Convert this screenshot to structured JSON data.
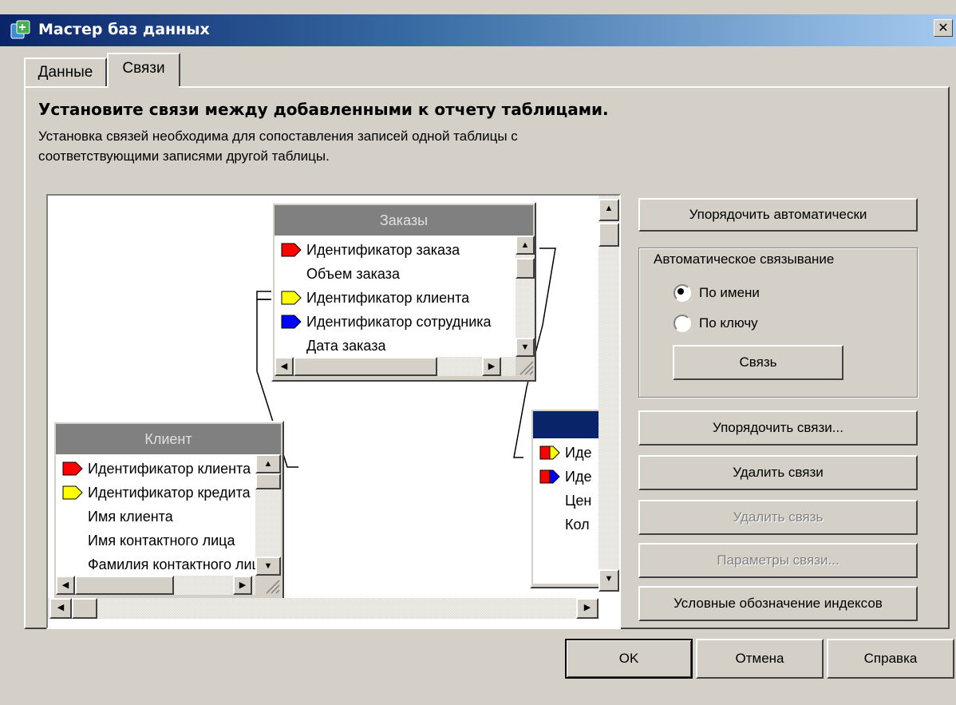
{
  "window": {
    "title": "Мастер баз данных",
    "close_glyph": "✕"
  },
  "tabs": [
    {
      "label": "Данные",
      "active": false
    },
    {
      "label": "Связи",
      "active": true
    }
  ],
  "heading": "Установите связи между добавленными к отчету таблицами.",
  "description_line1": "Установка связей необходима для сопоставления записей одной таблицы с",
  "description_line2": "соответствующими записями другой таблицы.",
  "tables": {
    "orders": {
      "title": "Заказы",
      "fields": [
        {
          "label": "Идентификатор заказа",
          "key": "red"
        },
        {
          "label": "Объем заказа",
          "key": ""
        },
        {
          "label": "Идентификатор клиента",
          "key": "yellow"
        },
        {
          "label": "Идентификатор сотрудника",
          "key": "blue"
        },
        {
          "label": "Дата заказа",
          "key": ""
        }
      ]
    },
    "client": {
      "title": "Клиент",
      "fields": [
        {
          "label": "Идентификатор клиента",
          "key": "red"
        },
        {
          "label": "Идентификатор кредита",
          "key": "yellow"
        },
        {
          "label": "Имя клиента",
          "key": ""
        },
        {
          "label": "Имя контактного лица",
          "key": ""
        },
        {
          "label": "Фамилия контактного лица",
          "key": ""
        }
      ]
    },
    "third": {
      "title": "",
      "fields": [
        {
          "label": "Иде",
          "key": "red-yellow"
        },
        {
          "label": "Иде",
          "key": "red-blue"
        },
        {
          "label": "Цен",
          "key": ""
        },
        {
          "label": "Кол",
          "key": ""
        }
      ]
    }
  },
  "buttons": {
    "arrange_auto": "Упорядочить автоматически",
    "link": "Связь",
    "arrange_links": "Упорядочить связи...",
    "delete_links": "Удалить связи",
    "delete_link": "Удалить связь",
    "link_params": "Параметры связи...",
    "index_legend": "Условные обозначение индексов",
    "ok": "OK",
    "cancel": "Отмена",
    "help": "Справка"
  },
  "auto_linking": {
    "title": "Автоматическое связывание",
    "options": [
      {
        "label": "По имени",
        "selected": true
      },
      {
        "label": "По ключу",
        "selected": false
      }
    ]
  },
  "colors": {
    "key_red": "#ff0000",
    "key_yellow": "#ffff00",
    "key_blue": "#0000ff",
    "title_blue": "#0a246a"
  }
}
